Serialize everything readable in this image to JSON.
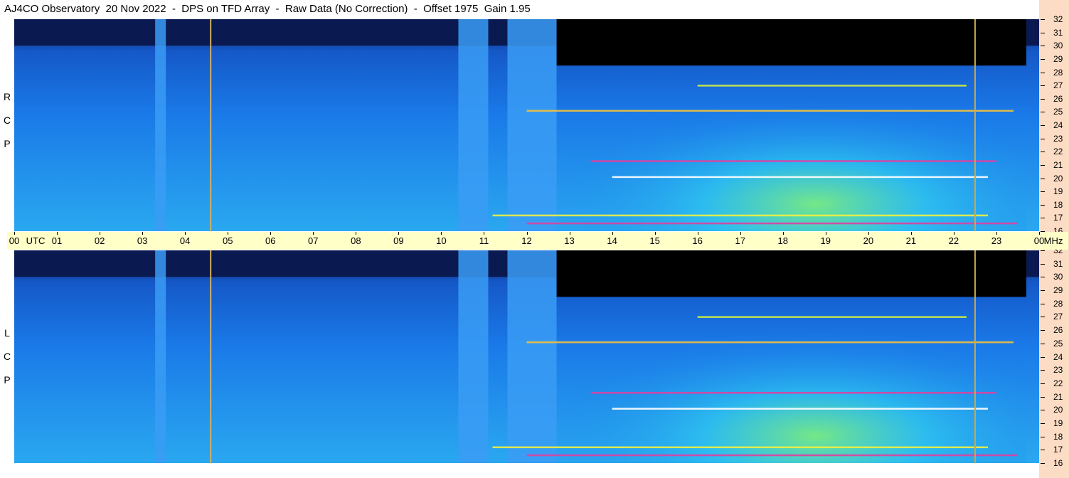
{
  "title": "AJ4CO Observatory  20 Nov 2022  -  DPS on TFD Array  -  Raw Data (No Correction)  -  Offset 1975  Gain 1.95",
  "panels": [
    {
      "polarization_letters": [
        "R",
        "C",
        "P"
      ]
    },
    {
      "polarization_letters": [
        "L",
        "C",
        "P"
      ]
    }
  ],
  "time_axis": {
    "labels": [
      "00",
      "UTC",
      "01",
      "02",
      "03",
      "04",
      "05",
      "06",
      "07",
      "08",
      "09",
      "10",
      "11",
      "12",
      "13",
      "14",
      "15",
      "16",
      "17",
      "18",
      "19",
      "20",
      "21",
      "22",
      "23",
      "00",
      "MHz"
    ]
  },
  "freq_axis": {
    "labels": [
      "32",
      "31",
      "30",
      "29",
      "28",
      "27",
      "26",
      "25",
      "24",
      "23",
      "22",
      "21",
      "20",
      "19",
      "18",
      "17",
      "16"
    ]
  },
  "chart_data": {
    "type": "heatmap",
    "title": "AJ4CO Observatory  20 Nov 2022  -  DPS on TFD Array  -  Raw Data (No Correction)  -  Offset 1975  Gain 1.95",
    "x_unit": "UTC hour",
    "x_range": [
      0,
      24
    ],
    "y_unit": "MHz",
    "y_range": [
      16,
      32
    ],
    "colors": {
      "background_low": "#0a1a50",
      "base_blue": "#1a7ae8",
      "elevated_cyan": "#2ec8f0",
      "high_green": "#7ef07a",
      "hot_yellow": "#f0f040",
      "peak_magenta": "#e040a0",
      "no_signal_black": "#000000"
    },
    "panels": [
      {
        "polarization": "RCP",
        "vertical_bands": [
          {
            "start": 3.3,
            "end": 3.55,
            "color": "#3a9cf5"
          },
          {
            "start": 10.4,
            "end": 11.1,
            "color": "#3a9cf5"
          },
          {
            "start": 11.55,
            "end": 12.7,
            "color": "#3a9cf5"
          }
        ],
        "vertical_lines": [
          {
            "x": 4.6,
            "color": "#d4b060"
          },
          {
            "x": 22.5,
            "color": "#c9a84c"
          }
        ],
        "night_cutoff_mhz": 30.0,
        "horizontal_bands": [
          {
            "mhz": 27.0,
            "start": 16,
            "end": 22.3,
            "color": "#d0f040"
          },
          {
            "mhz": 25.1,
            "start": 12,
            "end": 23.4,
            "color": "#f0c040"
          },
          {
            "mhz": 21.3,
            "start": 13.5,
            "end": 23,
            "color": "#e040a0"
          },
          {
            "mhz": 20.1,
            "start": 14,
            "end": 22.8,
            "color": "#ffffff"
          },
          {
            "mhz": 17.2,
            "start": 11.2,
            "end": 22.8,
            "color": "#f0f040"
          },
          {
            "mhz": 16.6,
            "start": 12,
            "end": 23.5,
            "color": "#e040a0"
          }
        ]
      },
      {
        "polarization": "LCP",
        "vertical_bands": [
          {
            "start": 3.3,
            "end": 3.55,
            "color": "#3a9cf5"
          },
          {
            "start": 10.4,
            "end": 11.1,
            "color": "#3a9cf5"
          },
          {
            "start": 11.55,
            "end": 12.7,
            "color": "#3a9cf5"
          }
        ],
        "vertical_lines": [
          {
            "x": 4.6,
            "color": "#d4b060"
          },
          {
            "x": 22.5,
            "color": "#c9a84c"
          }
        ],
        "night_cutoff_mhz": 30.0,
        "horizontal_bands": [
          {
            "mhz": 27.0,
            "start": 16,
            "end": 22.3,
            "color": "#d0f040"
          },
          {
            "mhz": 25.1,
            "start": 12,
            "end": 23.4,
            "color": "#f0c040"
          },
          {
            "mhz": 21.3,
            "start": 13.5,
            "end": 23,
            "color": "#e040a0"
          },
          {
            "mhz": 20.1,
            "start": 14,
            "end": 22.8,
            "color": "#ffffff"
          },
          {
            "mhz": 17.2,
            "start": 11.2,
            "end": 22.8,
            "color": "#f0f040"
          },
          {
            "mhz": 16.6,
            "start": 12,
            "end": 23.5,
            "color": "#e040a0"
          }
        ]
      }
    ]
  }
}
